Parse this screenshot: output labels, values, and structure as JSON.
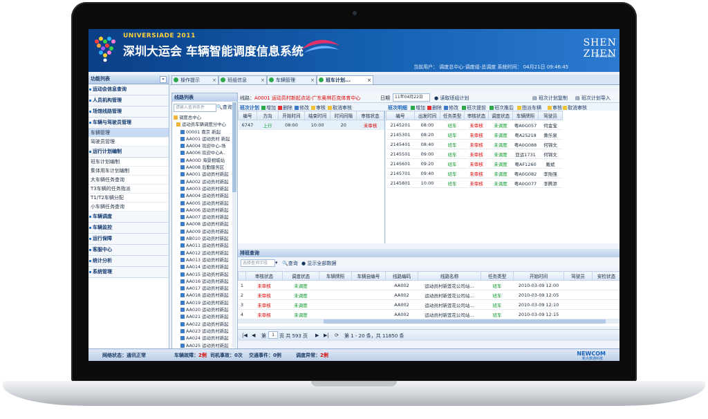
{
  "app": {
    "universiade": "UNIVERSIADE 2011",
    "title": "深圳大运会 车辆智能调度信息系统",
    "brand_top": "SHEN",
    "brand_bottom": "ZHEN",
    "brand_sub": "Shenzhen",
    "user_line": "当前用户：  调度总中心-调度组-总调度         系统时间：  04月21日   09:46:45"
  },
  "nav": {
    "header": "功能列表",
    "items": [
      {
        "type": "sec",
        "label": "运动会信息查询"
      },
      {
        "type": "sec",
        "label": "人员机构管理"
      },
      {
        "type": "sec",
        "label": "场馆线路管理"
      },
      {
        "type": "sec",
        "label": "车辆与驾驶员管理"
      },
      {
        "type": "sub",
        "label": "车辆管理",
        "active": true
      },
      {
        "type": "sub",
        "label": "驾驶员管理"
      },
      {
        "type": "sec",
        "label": "运行计划编制"
      },
      {
        "type": "sub",
        "label": "班车计划编制"
      },
      {
        "type": "sub",
        "label": "集体用车计划编制"
      },
      {
        "type": "sub",
        "label": "大车辆任务查询"
      },
      {
        "type": "sub",
        "label": "T3车辆的任务指派"
      },
      {
        "type": "sub",
        "label": "T1/T2车辆分配"
      },
      {
        "type": "sub",
        "label": "小车辆任务查询"
      },
      {
        "type": "sec",
        "label": "车辆调度"
      },
      {
        "type": "sec",
        "label": "车辆监控"
      },
      {
        "type": "sec",
        "label": "运行保障"
      },
      {
        "type": "sec",
        "label": "客服中心"
      },
      {
        "type": "sec",
        "label": "统计分析"
      },
      {
        "type": "sec",
        "label": "系统管理"
      }
    ]
  },
  "tabs": [
    {
      "label": "操作提示",
      "active": false
    },
    {
      "label": "班组信息",
      "active": false
    },
    {
      "label": "车辆管理",
      "active": false
    },
    {
      "label": "班车计划...",
      "active": true
    }
  ],
  "route_panel": {
    "title": "线路列表",
    "search_placeholder": "请输入查询条件",
    "search_btn": "查询",
    "tree": [
      "调度总中心",
      "运动员车辆调度分中心",
      "00001 南京 新起",
      "AA001 运动员村 新起",
      "AA004 欢迎中心-场",
      "AA006 欢迎中心A..",
      "AA00D 海景相城站",
      "AA008 后勤服务区",
      "AA001 运动员村新起",
      "AA002 运动员村新起",
      "AA003 运动员村新起",
      "AA004 运动员村新起",
      "AA005 运动员村新起",
      "AA006 运动员村新起",
      "AA007 运动员村新起",
      "AA008 运动员村新起",
      "AA009 运动员村新起",
      "AB010 运动员村新起",
      "AA011 运动员村新起",
      "AA012 运动员村新起",
      "AA013 运动员村新起",
      "AA014 运动员村新起",
      "AA015 运动员村新起",
      "AA016 运动员村新起",
      "AA017 运动员村新起",
      "AA018 运动员村新起",
      "AA019 运动员村新起",
      "AA020 运动员村新起",
      "AA021 运动员村新起",
      "AA022 运动员村新起",
      "AA023 运动员村新起",
      "AA024 运动员村新起",
      "AA025 运动员村新起"
    ]
  },
  "route_bar": {
    "route_label": "线路：",
    "route_value": "A0001 运动员村新起点站-广东奥林匹克体育中心",
    "date_label": "日期",
    "date_value": "11年04月22日",
    "read_plan": "读取班组计划",
    "copy_plan": "班次计划复制",
    "import_plan": "班次计划导入"
  },
  "plan": {
    "title": "班次计划",
    "buttons": [
      "增加",
      "删除",
      "修改",
      "审核",
      "取消审核"
    ],
    "columns": [
      "编号",
      "方向",
      "开始时间",
      "结束时间",
      "时间间隔",
      "审核状态"
    ],
    "rows": [
      [
        "6747",
        "上行",
        "08:00",
        "10:00",
        "20",
        "未审核"
      ]
    ]
  },
  "run": {
    "title": "班次明细",
    "buttons": [
      "增加",
      "删除",
      "修改",
      "班次提前",
      "班次推后",
      "指派车辆",
      "审核",
      "取消审核"
    ],
    "columns": [
      "编号",
      "出发时间",
      "任务类型",
      "审核状态",
      "调度状态",
      "车辆牌照",
      "驾驶员"
    ],
    "rows": [
      [
        "2145201",
        "08:00",
        "班车",
        "未审核",
        "未调度",
        "粤A0G057",
        "何金宝"
      ],
      [
        "2145301",
        "08:20",
        "班车",
        "未审核",
        "未调度",
        "粤A25218",
        "黄乐泉"
      ],
      [
        "2145401",
        "08:40",
        "班车",
        "未审核",
        "未调度",
        "粤A0G088",
        "何锦文"
      ],
      [
        "2145501",
        "09:00",
        "班车",
        "未审核",
        "未调度",
        "亚运1731",
        "何锦文"
      ],
      [
        "2145601",
        "09:20",
        "班车",
        "未审核",
        "未调度",
        "粤AF1260",
        "戴斌"
      ],
      [
        "2145701",
        "09:40",
        "班车",
        "未审核",
        "未调度",
        "粤A0G082",
        "李贻强"
      ],
      [
        "2145801",
        "10:00",
        "班车",
        "未审核",
        "未调度",
        "粤A0G077",
        "李腾添"
      ]
    ]
  },
  "query": {
    "title": "排班查询",
    "select_placeholder": "选择查询字段",
    "search_btn": "查询",
    "show_all": "显示全部数据",
    "columns": [
      "",
      "审核状态",
      "调度状态",
      "车辆牌照",
      "车辆自编号",
      "线路编码",
      "线路名称",
      "任务类型",
      "开始时间",
      "驾驶员",
      "安检状态"
    ],
    "rows": [
      [
        "1",
        "未审核",
        "未调度",
        "",
        "",
        "AA002",
        "运动员村新莲花公司站...",
        "班车",
        "2010-03-09 12:00",
        "",
        ""
      ],
      [
        "2",
        "未审核",
        "未调度",
        "",
        "",
        "AA002",
        "运动员村新莲花公司站...",
        "班车",
        "2010-03-09 12:05",
        "",
        ""
      ],
      [
        "3",
        "未审核",
        "未调度",
        "",
        "",
        "AA002",
        "运动员村新莲花公司站...",
        "班车",
        "2010-03-09 12:10",
        "",
        ""
      ],
      [
        "4",
        "未审核",
        "未调度",
        "",
        "",
        "AA002",
        "运动员村新莲花公司站...",
        "班车",
        "2010-03-09 12:15",
        "",
        ""
      ]
    ]
  },
  "pager": {
    "page_prefix": "第",
    "page_value": "1",
    "page_suffix": "页 共 593 页",
    "summary": "第 1 - 20 条，共 11850 条"
  },
  "footer": {
    "network": "网络状态：通讯正常",
    "fault_label": "车辆故障：",
    "fault_value": "2例",
    "driver_label": "司机事故：",
    "driver_value": "0次",
    "traffic_label": "交通事件：",
    "traffic_value": "0例",
    "dispatch_label": "调度异常：",
    "dispatch_value": "2例",
    "company": "NEWCOM",
    "company_sub": "新大数通科技"
  },
  "colors": {
    "header_blue": "#0b3f86",
    "accent_yellow": "#ffd23a",
    "status_green": "#0a9a2a",
    "status_red": "#e00000"
  }
}
